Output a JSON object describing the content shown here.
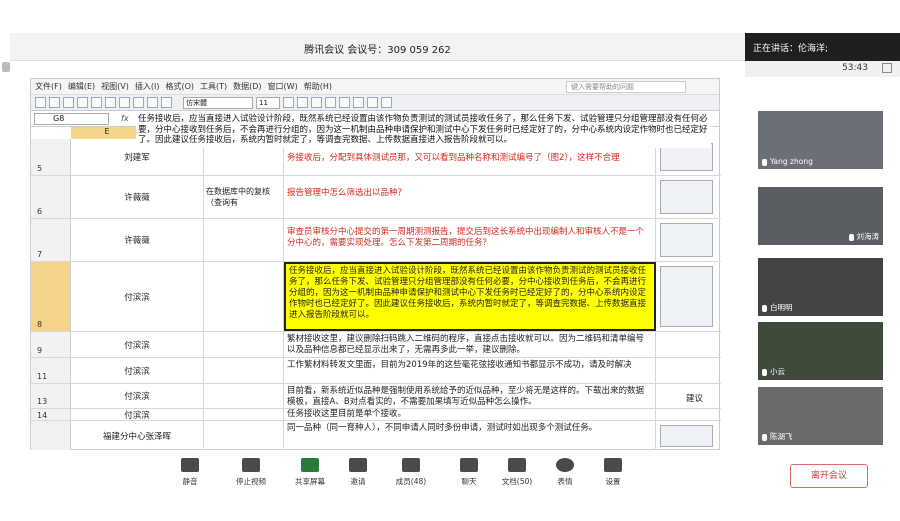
{
  "meeting": {
    "title": "腾讯会议 会议号：309 059 262",
    "speaker": "正在讲话：伦海洋;",
    "clock": "53:43"
  },
  "excel": {
    "menu": [
      "文件(F)",
      "编辑(E)",
      "视图(V)",
      "插入(I)",
      "格式(O)",
      "工具(T)",
      "数据(D)",
      "窗口(W)",
      "帮助(H)"
    ],
    "help_placeholder": "键入需要帮助的问题",
    "font": "仿宋體",
    "font_size": "11",
    "cell_ref": "G8",
    "column_header": "E",
    "popup_text": "任务接收后，应当直接进入试验设计阶段，既然系统已经设置由该作物负责测试的测试员接收任务了，那么任务下发、试验管理只分组管理部没有任何必要，分中心接收到任务后，不会再进行分组的，因为这一机制由品种申请保护和测试中心下发任务时已经定好了的，分中心系统内设定作物时也已经定好了。因此建议任务接收后，系统内暂时就定了，等调查完数据、上传数据直接进入报告阶段就可以。"
  },
  "rows": [
    {
      "num": "5",
      "person": "刘建军",
      "loc": "",
      "issue": "务接收后，分配到具体测试员那，又可以看到品种名称和测试编号了（图2），这样不合理"
    },
    {
      "num": "6",
      "person": "许薇薇",
      "loc": "在数据库中的复核（查询有",
      "issue": "报告管理中怎么筛选出以品种？"
    },
    {
      "num": "7",
      "person": "许薇薇",
      "loc": "",
      "issue": "审查员审核分中心提交的第一周期测测报告，提交后到这长系统中出现编制人和审核人不是一个分中心的，需要实现处理。怎么下发第二周期的任务？"
    },
    {
      "num": "8",
      "person": "付滨滨",
      "loc": "",
      "issue": "任务接收后，应当直接进入试验设计阶段，既然系统已经设置由该作物负责测试的测试员接收任务了，那么任务下发、试验管理只分组管理部没有任何必要，分中心接收到任务后，不会再进行分组的，因为这一机制由品种申请保护和测试中心下发任务时已经定好了的，分中心系统内设定作物时也已经定好了。因此建议任务接收后，系统内暂时就定了，等调查完数据、上传数据直接进入报告阶段就可以。"
    },
    {
      "num": "9",
      "person": "付滨滨",
      "loc": "",
      "issue": "繁材接收这里，建议删除扫码跳入二维码的程序，直接点击接收就可以。因为二维码和清单编号以及品种信息都已经显示出来了，无需再多此一举，建议删除。"
    },
    {
      "num": "11",
      "person": "付滨滨",
      "loc": "",
      "issue": "工作繁材料转发文里面，目前为2019年的这些毫花弦接收通知书都显示不成功，请及时解决"
    },
    {
      "num": "13",
      "person": "付滨滨",
      "loc": "",
      "issue": "目前看，新系统近似品种是强制使用系统给予的近似品种，至少将无是这样的。下载出来的数据模板，直接A、B对点看实的，不需要加果填写近似品种怎么操作。",
      "note": "建议"
    },
    {
      "num": "14",
      "person": "付滨滨",
      "loc": "",
      "issue": "任务接收这里目前是单个接收。"
    },
    {
      "num": "",
      "person": "福建分中心张泽晖",
      "loc": "",
      "issue": "同一品种（同一育种人），不同申请人同时多份申请，测试时如出现多个测试任务。"
    }
  ],
  "participants": [
    "Yang zhong",
    "刘海涛",
    "白明明",
    "小云",
    "陈湖飞"
  ],
  "toolbar": [
    "静音",
    "停止视频",
    "共享屏幕",
    "邀请",
    "成员(48)",
    "聊天",
    "文档(50)",
    "表情",
    "设置"
  ],
  "toolbar_leave": "",
  "toolbar_extra": {}
}
